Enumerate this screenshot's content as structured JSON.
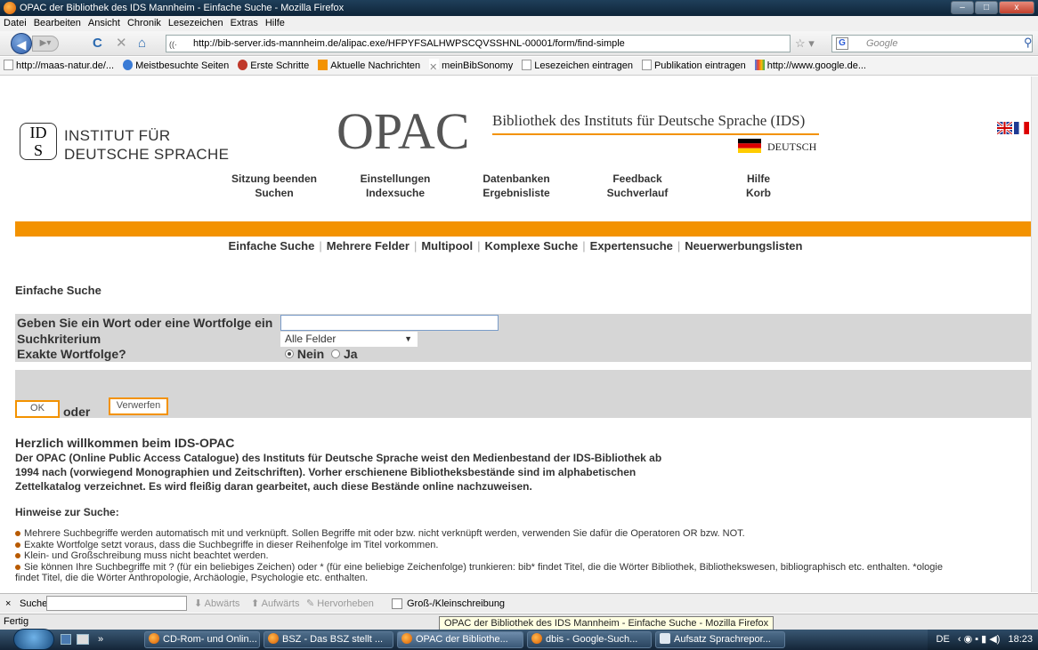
{
  "window": {
    "title": "OPAC der Bibliothek des IDS Mannheim - Einfache Suche - Mozilla Firefox",
    "minimize": "–",
    "maximize": "□",
    "close": "x"
  },
  "menubar": [
    "Datei",
    "Bearbeiten",
    "Ansicht",
    "Chronik",
    "Lesezeichen",
    "Extras",
    "Hilfe"
  ],
  "navbar": {
    "url": "http://bib-server.ids-mannheim.de/alipac.exe/HFPYFSALHWPSCQVSSHNL-00001/form/find-simple",
    "search_placeholder": "Google"
  },
  "bookmarks": [
    "http://maas-natur.de/...",
    "Meistbesuchte Seiten",
    "Erste Schritte",
    "Aktuelle Nachrichten",
    "meinBibSonomy",
    "Lesezeichen eintragen",
    "Publikation eintragen",
    "http://www.google.de..."
  ],
  "header": {
    "logo_mark": "IDS",
    "logo_line1": "INSTITUT FÜR",
    "logo_line2": "DEUTSCHE SPRACHE",
    "opac": "OPAC",
    "subtitle": "Bibliothek des Instituts für Deutsche Sprache (IDS)",
    "language": "DEUTSCH"
  },
  "topnav": [
    "Sitzung beenden",
    "Einstellungen",
    "Datenbanken",
    "Feedback",
    "Hilfe",
    "Suchen",
    "Indexsuche",
    "Ergebnisliste",
    "Suchverlauf",
    "Korb"
  ],
  "subnav": [
    "Einfache Suche",
    "Mehrere Felder",
    "Multipool",
    "Komplexe Suche",
    "Expertensuche",
    "Neuerwerbungslisten"
  ],
  "page_heading": "Einfache Suche",
  "form": {
    "word_label": "Geben Sie ein Wort oder eine Wortfolge ein",
    "word_value": "",
    "criterion_label": "Suchkriterium",
    "criterion_value": "Alle Felder",
    "exact_label": "Exakte Wortfolge?",
    "exact_no": "Nein",
    "exact_yes": "Ja",
    "ok_button": "OK",
    "oder": "oder",
    "reset_button": "Verwerfen"
  },
  "welcome": {
    "heading": "Herzlich willkommen beim IDS-OPAC",
    "text": "Der OPAC (Online Public Access Catalogue) des Instituts für Deutsche Sprache weist den Medienbestand der IDS-Bibliothek ab 1994 nach (vorwiegend Monographien und Zeitschriften). Vorher erschienene Bibliotheksbestände sind im alphabetischen Zettelkatalog verzeichnet. Es wird fleißig daran gearbeitet, auch diese Bestände online nachzuweisen."
  },
  "hints": {
    "heading": "Hinweise zur Suche:",
    "items": [
      "Mehrere Suchbegriffe werden automatisch mit und verknüpft. Sollen Begriffe mit oder bzw. nicht verknüpft werden, verwenden Sie dafür die Operatoren OR bzw. NOT.",
      "Exakte Wortfolge setzt voraus, dass die Suchbegriffe in dieser Reihenfolge im Titel vorkommen.",
      "Klein- und Großschreibung muss nicht beachtet werden.",
      "Sie können Ihre Suchbegriffe mit ? (für ein beliebiges Zeichen) oder * (für eine beliebige Zeichenfolge) trunkieren: bib* findet Titel, die die Wörter Bibliothek, Bibliothekswesen, bibliographisch etc. enthalten. *ologie",
      "findet Titel, die die Wörter Anthropologie, Archäologie, Psychologie etc. enthalten."
    ]
  },
  "findbar": {
    "close": "×",
    "label": "Suchen:",
    "down": "Abwärts",
    "up": "Aufwärts",
    "highlight": "Hervorheben",
    "case": "Groß-/Kleinschreibung"
  },
  "status": {
    "text": "Fertig",
    "tooltip": "OPAC der Bibliothek des IDS Mannheim - Einfache Suche - Mozilla Firefox"
  },
  "taskbar": {
    "quick_more": "»",
    "tasks": [
      "CD-Rom- und Onlin...",
      "BSZ - Das BSZ stellt ...",
      "OPAC der Bibliothe...",
      "dbis - Google-Such...",
      "Aufsatz Sprachrepor..."
    ],
    "lang": "DE",
    "time": "18:23"
  }
}
